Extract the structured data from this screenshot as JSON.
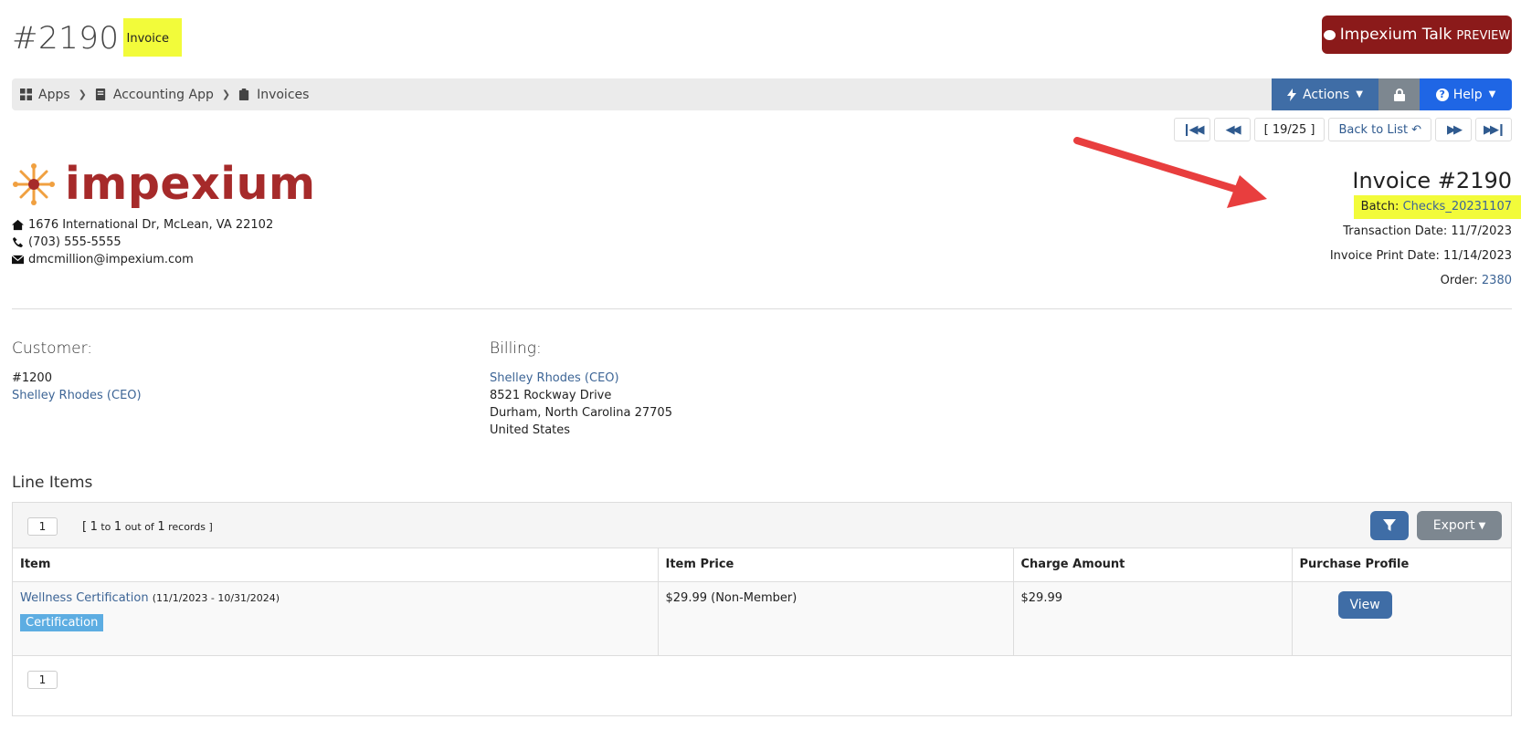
{
  "header": {
    "number": "#2190",
    "type": "Invoice",
    "talk_button": {
      "label": "Impexium Talk",
      "badge": "PREVIEW"
    }
  },
  "breadcrumb": {
    "items": [
      "Apps",
      "Accounting App",
      "Invoices"
    ],
    "actions_label": "Actions",
    "help_label": "Help"
  },
  "pager": {
    "position": "[ 19/25 ]",
    "back_label": "Back to List"
  },
  "company": {
    "logo_text": "impexium",
    "address": "1676 International Dr, McLean, VA 22102",
    "phone": "(703) 555-5555",
    "email": "dmcmillion@impexium.com"
  },
  "invoice": {
    "title": "Invoice #2190",
    "batch_label": "Batch:",
    "batch_value": "Checks_20231107",
    "transaction_date": "Transaction Date: 11/7/2023",
    "print_date": "Invoice Print Date: 11/14/2023",
    "order_label": "Order:",
    "order_value": "2380"
  },
  "customer": {
    "title": "Customer:",
    "id": "#1200",
    "name": "Shelley Rhodes (CEO)"
  },
  "billing": {
    "title": "Billing:",
    "name": "Shelley Rhodes (CEO)",
    "street": "8521 Rockway Drive",
    "city": "Durham, North Carolina 27705",
    "country": "United States"
  },
  "line_items": {
    "title": "Line Items",
    "page": "1",
    "records_open": "[",
    "records_from": "1",
    "records_to_word": "to",
    "records_to": "1",
    "records_of_word": "out of",
    "records_total": "1",
    "records_word": "records ]",
    "export_label": "Export",
    "columns": [
      "Item",
      "Item Price",
      "Charge Amount",
      "Purchase Profile"
    ],
    "rows": [
      {
        "item": "Wellness Certification",
        "dates": "(11/1/2023 - 10/31/2024)",
        "tag": "Certification",
        "price": "$29.99 (Non-Member)",
        "charge": "$29.99",
        "action": "View"
      }
    ],
    "bottom_page": "1"
  },
  "colors": {
    "brand_red": "#a62a2a",
    "primary": "#3f6da6",
    "help_blue": "#1f66e5",
    "highlight": "#f2fb3a",
    "annotation_arrow": "#e83e3e"
  }
}
